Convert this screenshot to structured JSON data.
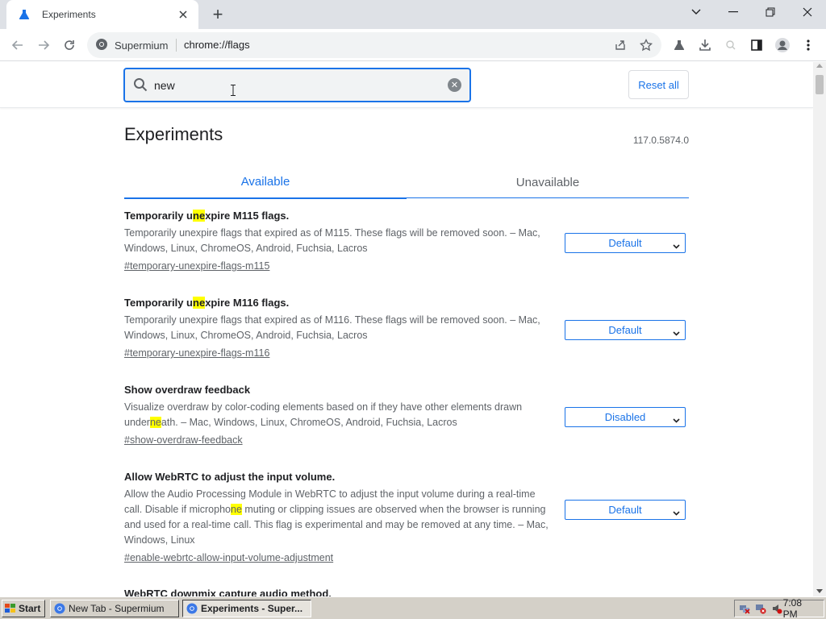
{
  "browser": {
    "tab_title": "Experiments",
    "new_tab_symbol": "+",
    "site_name": "Supermium",
    "url": "chrome://flags"
  },
  "page": {
    "search_value": "new",
    "reset_label": "Reset all",
    "heading": "Experiments",
    "version": "117.0.5874.0",
    "tabs": [
      {
        "label": "Available",
        "active": true
      },
      {
        "label": "Unavailable",
        "active": false
      }
    ],
    "flags": [
      {
        "name_pre": "Temporarily u",
        "name_hl": "ne",
        "name_post": "xpire M115 flags.",
        "desc_pre": "Temporarily unexpire flags that expired as of M115. These flags will be removed soon. – Mac, Windows, Linux, ChromeOS, Android, Fuchsia, Lacros",
        "desc_hl": "",
        "desc_post": "",
        "link": "#temporary-unexpire-flags-m115",
        "value": "Default"
      },
      {
        "name_pre": "Temporarily u",
        "name_hl": "ne",
        "name_post": "xpire M116 flags.",
        "desc_pre": "Temporarily unexpire flags that expired as of M116. These flags will be removed soon. – Mac, Windows, Linux, ChromeOS, Android, Fuchsia, Lacros",
        "desc_hl": "",
        "desc_post": "",
        "link": "#temporary-unexpire-flags-m116",
        "value": "Default"
      },
      {
        "name_pre": "Show overdraw feedback",
        "name_hl": "",
        "name_post": "",
        "desc_pre": "Visualize overdraw by color-coding elements based on if they have other elements drawn under",
        "desc_hl": "ne",
        "desc_post": "ath. – Mac, Windows, Linux, ChromeOS, Android, Fuchsia, Lacros",
        "link": "#show-overdraw-feedback",
        "value": "Disabled"
      },
      {
        "name_pre": "Allow WebRTC to adjust the input volume.",
        "name_hl": "",
        "name_post": "",
        "desc_pre": "Allow the Audio Processing Module in WebRTC to adjust the input volume during a real-time call. Disable if micropho",
        "desc_hl": "ne",
        "desc_post": " muting or clipping issues are observed when the browser is running and used for a real-time call. This flag is experimental and may be removed at any time. – Mac, Windows, Linux",
        "link": "#enable-webrtc-allow-input-volume-adjustment",
        "value": "Default"
      },
      {
        "name_pre": "WebRTC downmix capture audio method.",
        "name_hl": "",
        "name_post": "",
        "desc_pre": "",
        "desc_hl": "",
        "desc_post": "",
        "link": "",
        "value": ""
      }
    ]
  },
  "taskbar": {
    "start_label": "Start",
    "tasks": [
      {
        "label": "New Tab - Supermium",
        "active": false
      },
      {
        "label": "Experiments - Super...",
        "active": true
      }
    ],
    "clock": "7:08 PM"
  },
  "colors": {
    "accent": "#1a73e8",
    "highlight": "#ffff00"
  }
}
